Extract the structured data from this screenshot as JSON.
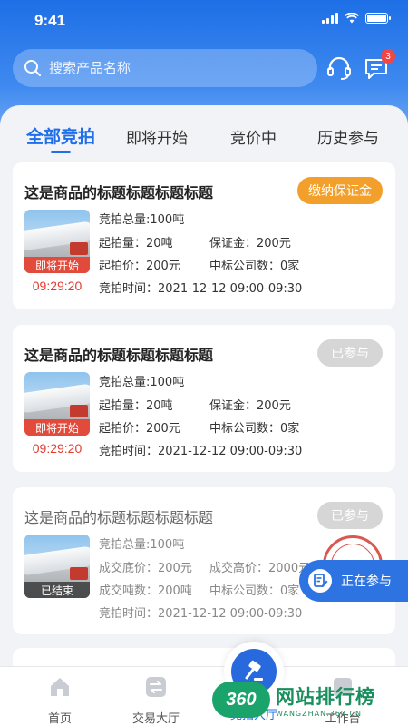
{
  "status": {
    "time": "9:41"
  },
  "search": {
    "placeholder": "搜索产品名称"
  },
  "header": {
    "message_badge": "3"
  },
  "tabs": [
    {
      "label": "全部竞拍",
      "active": true
    },
    {
      "label": "即将开始",
      "active": false
    },
    {
      "label": "竞价中",
      "active": false
    },
    {
      "label": "历史参与",
      "active": false
    }
  ],
  "cards": [
    {
      "title": "这是商品的标题标题标题标题",
      "action": "缴纳保证金",
      "status_label": "即将开始",
      "countdown": "09:29:20",
      "total": "竞拍总量:100吨",
      "row1_left": "起拍量：20吨",
      "row1_right": "保证金：200元",
      "row2_left": "起拍价：200元",
      "row2_right": "中标公司数：0家",
      "time": "竞拍时间：2021-12-12 09:00-09:30"
    },
    {
      "title": "这是商品的标题标题标题标题",
      "action": "已参与",
      "status_label": "即将开始",
      "countdown": "09:29:20",
      "total": "竞拍总量:100吨",
      "row1_left": "起拍量：20吨",
      "row1_right": "保证金：200元",
      "row2_left": "起拍价：200元",
      "row2_right": "中标公司数：0家",
      "time": "竞拍时间：2021-12-12 09:00-09:30"
    },
    {
      "title": "这是商品的标题标题标题标题",
      "action": "已参与",
      "status_label": "已结束",
      "total": "竞拍总量:100吨",
      "row1_left": "成交底价：200元",
      "row1_right": "成交高价：2000元",
      "row2_left": "成交吨数：200吨",
      "row2_right": "中标公司数：0家",
      "time": "竞拍时间：2021-12-12 09:00-09:30"
    }
  ],
  "floating": {
    "label": "正在参与"
  },
  "tabbar": [
    {
      "label": "首页"
    },
    {
      "label": "交易大厅"
    },
    {
      "label": "竞拍大厅"
    },
    {
      "label": "工作台"
    }
  ],
  "watermark": {
    "logo": "360",
    "cn": "网站排行榜",
    "en": "WANGZHAN.360.CN"
  },
  "colors": {
    "primary": "#1f6fe8",
    "accent_orange": "#f2a02b",
    "alert_red": "#e23b2e",
    "watermark_green": "#1a8f5e"
  }
}
